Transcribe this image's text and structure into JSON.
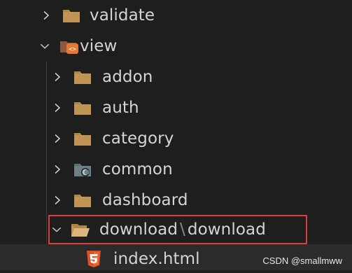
{
  "explorer": {
    "items": [
      {
        "label": "validate",
        "expanded": false,
        "icon": "folder-icon"
      },
      {
        "label": "view",
        "expanded": true,
        "icon": "folder-view-icon"
      },
      {
        "label": "addon",
        "expanded": false,
        "icon": "folder-icon"
      },
      {
        "label": "auth",
        "expanded": false,
        "icon": "folder-icon"
      },
      {
        "label": "category",
        "expanded": false,
        "icon": "folder-icon"
      },
      {
        "label": "common",
        "expanded": false,
        "icon": "folder-common-icon"
      },
      {
        "label": "dashboard",
        "expanded": false,
        "icon": "folder-icon"
      },
      {
        "label_part1": "download",
        "separator": "\\",
        "label_part2": "download",
        "expanded": true,
        "icon": "folder-open-icon"
      },
      {
        "label": "index.html",
        "icon": "html5-icon"
      }
    ],
    "colors": {
      "folder": "#c09553",
      "folder_open": "#dcb67a",
      "view_badge": "#e37933",
      "common_folder": "#6d8086",
      "html5": "#e44d26",
      "selection_border": "#e53935"
    }
  },
  "watermark": "CSDN @smallmww"
}
